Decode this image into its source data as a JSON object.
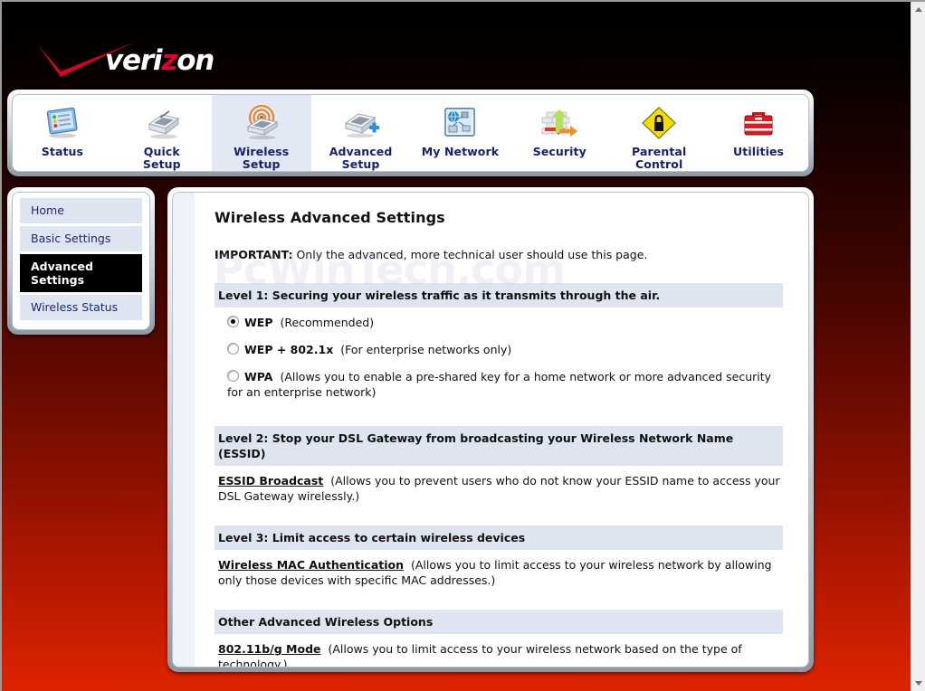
{
  "brand": {
    "name": "verizon",
    "logo_mark": "checkmark",
    "accent_color": "#e4002b"
  },
  "nav": {
    "items": [
      {
        "label": "Status",
        "icon": "status-monitor-icon",
        "active": false
      },
      {
        "label": "Quick\nSetup",
        "label_line1": "Quick",
        "label_line2": "Setup",
        "icon": "router-icon",
        "active": false
      },
      {
        "label": "Wireless Setup",
        "label_line1": "Wireless",
        "label_line2": "Setup",
        "icon": "wireless-router-icon",
        "active": true
      },
      {
        "label": "Advanced Setup",
        "label_line1": "Advanced",
        "label_line2": "Setup",
        "icon": "router-plus-icon",
        "active": false
      },
      {
        "label": "My Network",
        "label_line1": "My Network",
        "label_line2": "",
        "icon": "network-globe-icon",
        "active": false
      },
      {
        "label": "Security",
        "label_line1": "Security",
        "label_line2": "",
        "icon": "firewall-icon",
        "active": false
      },
      {
        "label": "Parental Control",
        "label_line1": "Parental",
        "label_line2": "Control",
        "icon": "padlock-diamond-icon",
        "active": false
      },
      {
        "label": "Utilities",
        "label_line1": "Utilities",
        "label_line2": "",
        "icon": "toolbox-icon",
        "active": false
      }
    ]
  },
  "sidebar": {
    "items": [
      {
        "label": "Home",
        "selected": false
      },
      {
        "label": "Basic Settings",
        "selected": false
      },
      {
        "label": "Advanced Settings",
        "label_line1": "Advanced",
        "label_line2": "Settings",
        "selected": true
      },
      {
        "label": "Wireless Status",
        "selected": false
      }
    ]
  },
  "main": {
    "title": "Wireless Advanced Settings",
    "important_label": "IMPORTANT:",
    "important_text": " Only the advanced, more technical user should use this page.",
    "watermark": "PcWinTech.com",
    "level1": {
      "heading": "Level 1: Securing your wireless traffic as it transmits through the air.",
      "options": [
        {
          "name": "WEP",
          "note": "(Recommended)",
          "checked": true
        },
        {
          "name": "WEP + 802.1x",
          "note": "(For enterprise networks only)",
          "checked": false
        },
        {
          "name": "WPA",
          "note": "(Allows you to enable a pre-shared key for a home network or more advanced security for an enterprise network)",
          "checked": false
        }
      ]
    },
    "level2": {
      "heading": "Level 2: Stop your DSL Gateway from broadcasting your Wireless Network Name (ESSID)",
      "link": "ESSID Broadcast",
      "note": "(Allows you to prevent users who do not know your ESSID name to access your DSL Gateway wirelessly.)"
    },
    "level3": {
      "heading": "Level 3: Limit access to certain wireless devices",
      "link": "Wireless MAC Authentication",
      "note": "(Allows you to limit access to your wireless network by allowing only those devices with specific MAC addresses.)"
    },
    "other": {
      "heading": "Other Advanced Wireless Options",
      "link": "802.11b/g Mode",
      "note": "(Allows you to limit access to your wireless network based on the type of technology.)"
    }
  },
  "scrollbar": {
    "up_arrow": "scroll-up-arrow",
    "down_arrow": "scroll-down-arrow"
  },
  "colors": {
    "section_header_bg": "#dfe5f0",
    "nav_label": "#16236b",
    "background_top": "#000000",
    "background_bottom": "#dc2300"
  }
}
